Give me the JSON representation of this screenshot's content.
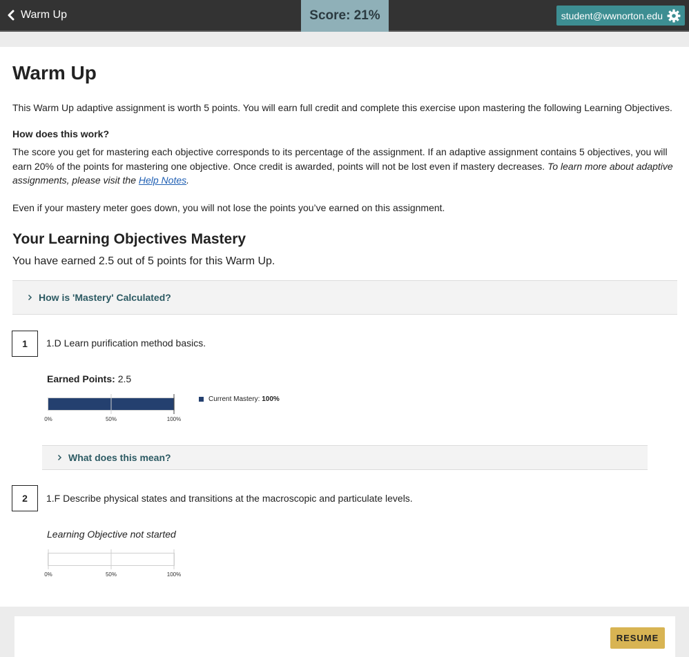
{
  "header": {
    "back_label": "Warm Up",
    "score_label": "Score: 21%",
    "user_email": "student@wwnorton.edu"
  },
  "page": {
    "title": "Warm Up",
    "intro": "This Warm Up adaptive assignment is worth 5 points. You will earn full credit and complete this exercise upon mastering the following Learning Objectives.",
    "how_title": "How does this work?",
    "how_text": "The score you get for mastering each objective corresponds to its percentage of the assignment. If an adaptive assignment contains 5 objectives, you will earn 20% of the points for mastering one objective. Once credit is awarded, points will not be lost even if mastery decreases. ",
    "how_italic": "To learn more about adaptive assignments, please visit the ",
    "help_link": "Help Notes",
    "help_suffix": ".",
    "even_text": "Even if your mastery meter goes down, you will not lose the points you’ve earned on this assignment.",
    "mastery_heading": "Your Learning Objectives Mastery",
    "earned_summary": "You have earned 2.5 out of 5 points for this Warm Up.",
    "mastery_calc_label": "How is 'Mastery' Calculated?"
  },
  "objectives": [
    {
      "number": "1",
      "text": "1.D Learn purification method basics.",
      "earned_label": "Earned Points:",
      "earned_value": "2.5",
      "mastery": 1.0,
      "legend_label": "Current Mastery:",
      "legend_value": "100%",
      "explain_label": "What does this mean?"
    },
    {
      "number": "2",
      "text": "1.F Describe physical states and transitions at the macroscopic and particulate levels.",
      "status": "Learning Objective not started",
      "mastery": 0
    }
  ],
  "bar_ticks": [
    "0%",
    "50%",
    "100%"
  ],
  "footer": {
    "resume_label": "RESUME"
  },
  "colors": {
    "topbar": "#333333",
    "score_bg": "#8fb0b8",
    "user_bg": "#3d8e92",
    "bar_fill": "#24406f",
    "link_teal": "#2c5a63",
    "resume_bg": "#d8b453"
  }
}
